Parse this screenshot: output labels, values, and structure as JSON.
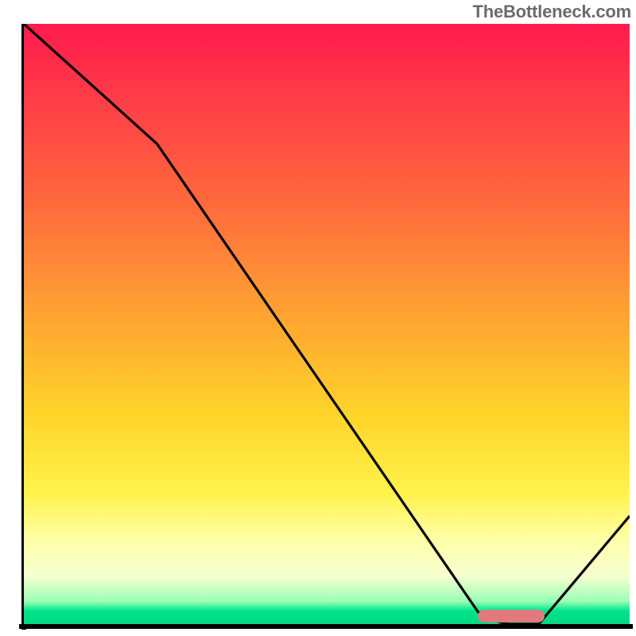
{
  "watermark": "TheBottleneck.com",
  "chart_data": {
    "type": "line",
    "title": "",
    "xlabel": "",
    "ylabel": "",
    "xlim": [
      0,
      100
    ],
    "ylim": [
      0,
      100
    ],
    "grid": false,
    "series": [
      {
        "name": "bottleneck-curve",
        "x": [
          0,
          22,
          75,
          80,
          85,
          100
        ],
        "values": [
          100,
          80,
          2,
          0,
          0,
          18
        ]
      }
    ],
    "annotations": [
      {
        "name": "optimal-range-marker",
        "x_start": 75,
        "x_end": 86,
        "y": 0.8
      }
    ],
    "background_gradient": {
      "stops": [
        {
          "pos": 0,
          "color": "#ff1a4d"
        },
        {
          "pos": 0.3,
          "color": "#ff6a3d"
        },
        {
          "pos": 0.65,
          "color": "#ffd42a"
        },
        {
          "pos": 0.86,
          "color": "#ffffa8"
        },
        {
          "pos": 0.97,
          "color": "#00e38b"
        },
        {
          "pos": 1.0,
          "color": "#00d980"
        }
      ]
    }
  }
}
